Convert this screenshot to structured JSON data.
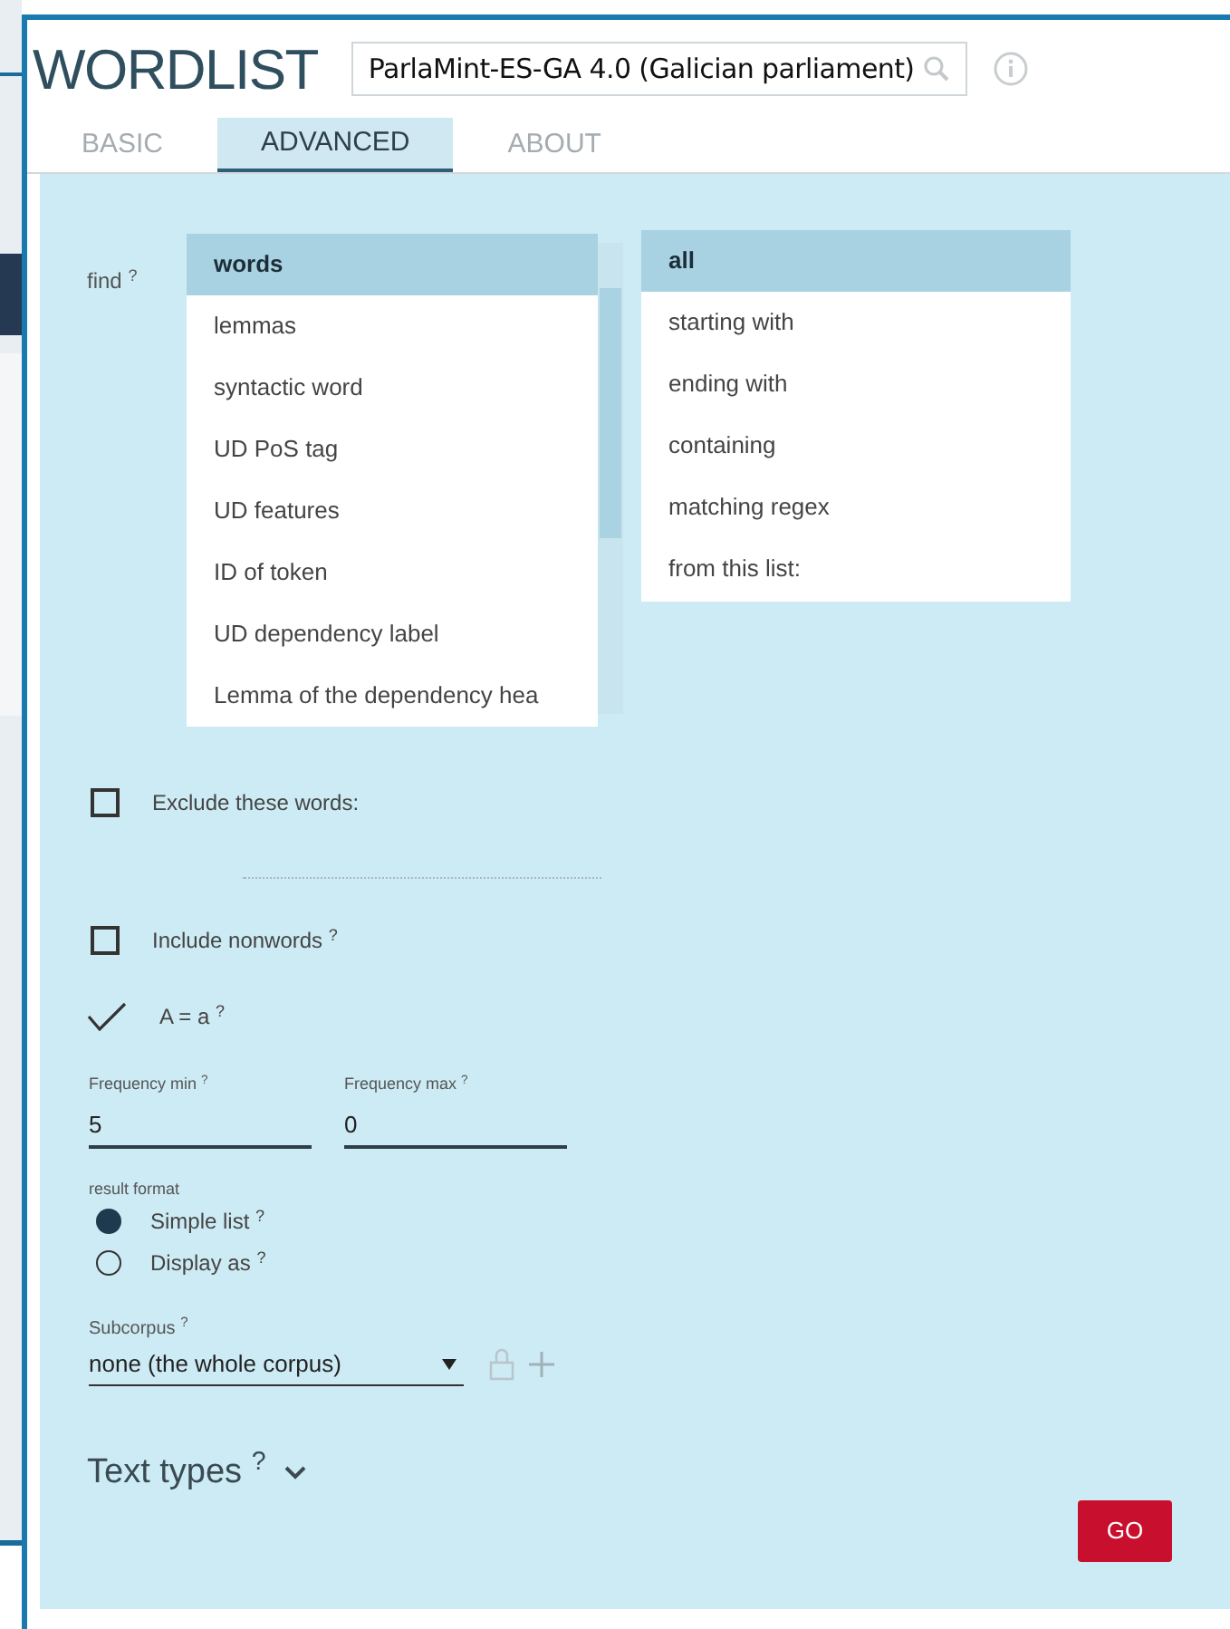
{
  "app": {
    "title": "WORDLIST"
  },
  "corpus_search": {
    "value": "ParlaMint-ES-GA 4.0 (Galician parliament)"
  },
  "tabs": [
    {
      "label": "BASIC",
      "selected": false
    },
    {
      "label": "ADVANCED",
      "selected": true
    },
    {
      "label": "ABOUT",
      "selected": false
    }
  ],
  "find": {
    "label": "find $^{?}$",
    "attributes": [
      {
        "label": "words",
        "selected": true
      },
      {
        "label": "lemmas",
        "selected": false
      },
      {
        "label": "syntactic word",
        "selected": false
      },
      {
        "label": "UD PoS tag",
        "selected": false
      },
      {
        "label": "UD features",
        "selected": false
      },
      {
        "label": "ID of token",
        "selected": false
      },
      {
        "label": "UD dependency label",
        "selected": false
      },
      {
        "label": "Lemma of the dependency hea",
        "selected": false
      }
    ],
    "criteria": [
      {
        "label": "all",
        "selected": true
      },
      {
        "label": "starting with",
        "selected": false
      },
      {
        "label": "ending with",
        "selected": false
      },
      {
        "label": "containing",
        "selected": false
      },
      {
        "label": "matching regex",
        "selected": false
      },
      {
        "label": "from this list:",
        "selected": false
      }
    ]
  },
  "options": [
    {
      "kind": "checkbox",
      "label": "Exclude these words:",
      "checked": false
    },
    {
      "kind": "textline"
    },
    {
      "kind": "checkbox",
      "label": "Include nonwords $^{?}$",
      "checked": false
    },
    {
      "kind": "tick",
      "label": "A = a $^{?}$",
      "checked": true
    }
  ],
  "frequency": [
    {
      "label": "Frequency min $^{?}$",
      "value": "5"
    },
    {
      "label": "Frequency max $^{?}$",
      "value": "0"
    }
  ],
  "result_format": {
    "label": "result format",
    "choices": [
      {
        "label": "Simple list $^{?}$",
        "selected": true
      },
      {
        "label": "Display as $^{?}$",
        "selected": false
      }
    ]
  },
  "subcorpus": {
    "label": "Subcorpus $^{?}$",
    "value": "none (the whole corpus)"
  },
  "text_types": {
    "label": "Text types $^{?}$",
    "expanded": false
  },
  "go_button": {
    "label": "GO"
  }
}
